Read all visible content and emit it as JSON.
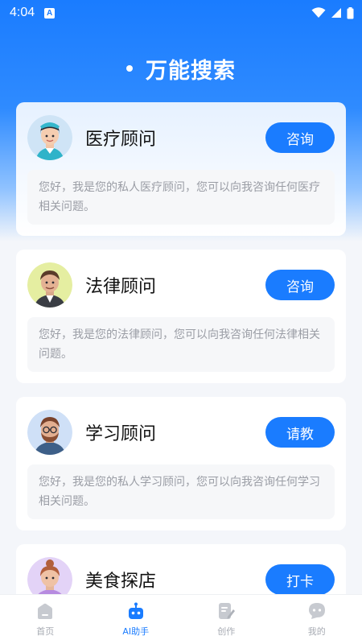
{
  "status": {
    "time": "4:04",
    "notif_letter": "A"
  },
  "page": {
    "title": "万能搜索"
  },
  "cards": [
    {
      "name": "医疗顾问",
      "button": "咨询",
      "desc": "您好，我是您的私人医疗顾问，您可以向我咨询任何医疗相关问题。",
      "avatar_bg": "#cfe4f6"
    },
    {
      "name": "法律顾问",
      "button": "咨询",
      "desc": "您好，我是您的法律顾问，您可以向我咨询任何法律相关问题。",
      "avatar_bg": "#e5eea1"
    },
    {
      "name": "学习顾问",
      "button": "请教",
      "desc": "您好，我是您的私人学习顾问，您可以向我咨询任何学习相关问题。",
      "avatar_bg": "#cfe0f7"
    },
    {
      "name": "美食探店",
      "button": "打卡",
      "desc": "",
      "avatar_bg": "#e3d3f7"
    }
  ],
  "tabs": [
    {
      "label": "首页",
      "icon": "home-icon",
      "active": false
    },
    {
      "label": "AI助手",
      "icon": "robot-icon",
      "active": true
    },
    {
      "label": "创作",
      "icon": "edit-icon",
      "active": false
    },
    {
      "label": "我的",
      "icon": "profile-icon",
      "active": false
    }
  ],
  "colors": {
    "accent": "#1a7cff",
    "inactive": "#a7abb3"
  }
}
